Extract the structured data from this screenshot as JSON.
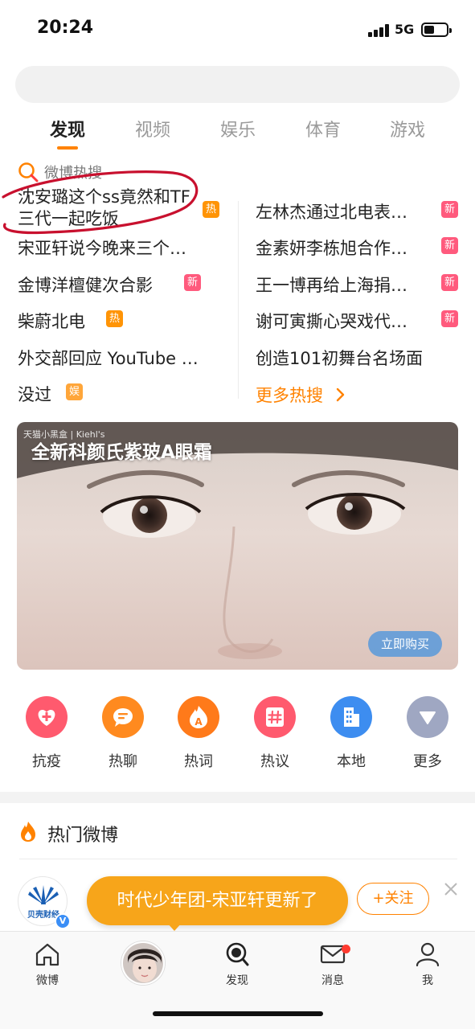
{
  "status_bar": {
    "time": "20:24",
    "network": "5G"
  },
  "tabs": [
    {
      "label": "发现",
      "active": true
    },
    {
      "label": "视频",
      "active": false
    },
    {
      "label": "娱乐",
      "active": false
    },
    {
      "label": "体育",
      "active": false
    },
    {
      "label": "游戏",
      "active": false
    }
  ],
  "hot_search": {
    "title": "微博热搜",
    "left": [
      {
        "text": "沈安璐这个ss竟然和TF三代一起吃饭",
        "badge": "热"
      },
      {
        "text": "宋亚轩说今晚来三个…",
        "badge": ""
      },
      {
        "text": "金博洋檀健次合影",
        "badge": "新"
      },
      {
        "text": "柴蔚北电",
        "badge": "热"
      },
      {
        "text": "外交部回应 YouTube …",
        "badge": ""
      },
      {
        "text": "没过",
        "badge": "娱"
      }
    ],
    "right": [
      {
        "text": "左林杰通过北电表…",
        "badge": "新"
      },
      {
        "text": "金素妍李栋旭合作…",
        "badge": "新"
      },
      {
        "text": "王一博再给上海捐…",
        "badge": "新"
      },
      {
        "text": "谢可寅撕心哭戏代…",
        "badge": "新"
      },
      {
        "text": "创造101初舞台名场面",
        "badge": ""
      }
    ],
    "more": "更多热搜"
  },
  "banner": {
    "title": "全新科颜氏紫玻A眼霜",
    "brand": "天猫小黑盒 | Kiehl's",
    "cta": "立即购买"
  },
  "quick_links": [
    {
      "label": "抗疫",
      "icon": "heart-plus-icon",
      "color": "#ff5a6e"
    },
    {
      "label": "热聊",
      "icon": "chat-bubble-icon",
      "color": "#ff8a1f"
    },
    {
      "label": "热词",
      "icon": "flame-a-icon",
      "color": "#ff7a1a"
    },
    {
      "label": "热议",
      "icon": "hashtag-icon",
      "color": "#ff5a6e"
    },
    {
      "label": "本地",
      "icon": "building-icon",
      "color": "#3d8df0"
    },
    {
      "label": "更多",
      "icon": "triangle-down-icon",
      "color": "#9fa7c2"
    }
  ],
  "hot_weibo": {
    "title": "热门微博"
  },
  "feed": {
    "avatar_text": "贝壳财经",
    "follow_label": "+关注",
    "toast": "时代少年团-宋亚轩更新了"
  },
  "bottom_nav": [
    {
      "label": "微博",
      "icon": "home-icon"
    },
    {
      "label": "",
      "icon": "avatar"
    },
    {
      "label": "发现",
      "icon": "discover-icon"
    },
    {
      "label": "消息",
      "icon": "mail-icon"
    },
    {
      "label": "我",
      "icon": "person-icon"
    }
  ],
  "colors": {
    "accent": "#ff8200",
    "new_badge": "#ff5a7d",
    "hot_badge": "#ff9406"
  }
}
